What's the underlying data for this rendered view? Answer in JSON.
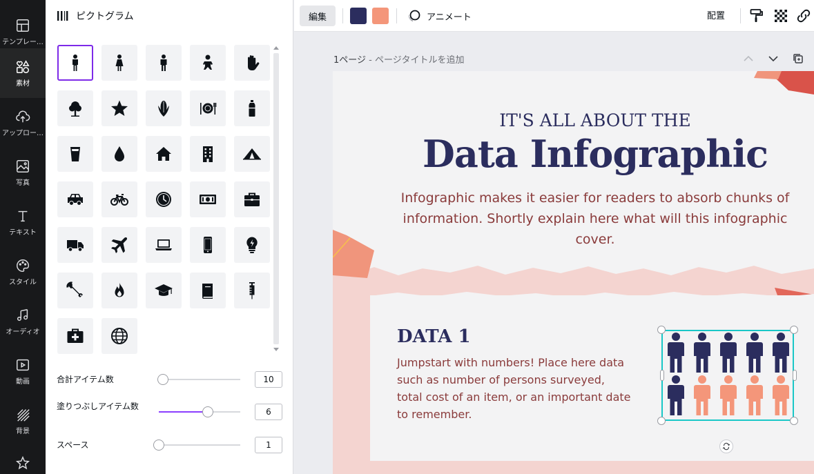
{
  "rail": [
    {
      "label": "テンプレー…",
      "icon": "template-icon"
    },
    {
      "label": "素材",
      "icon": "elements-icon",
      "active": true
    },
    {
      "label": "アップロー…",
      "icon": "upload-icon"
    },
    {
      "label": "写真",
      "icon": "photo-icon"
    },
    {
      "label": "テキスト",
      "icon": "text-icon"
    },
    {
      "label": "スタイル",
      "icon": "palette-icon"
    },
    {
      "label": "オーディオ",
      "icon": "music-icon"
    },
    {
      "label": "動画",
      "icon": "video-icon"
    },
    {
      "label": "背景",
      "icon": "background-icon"
    },
    {
      "label": "",
      "icon": "star-icon"
    }
  ],
  "panel": {
    "title": "ピクトグラム",
    "controls": {
      "total_label": "合計アイテム数",
      "total_value": "10",
      "total_level": 0.05,
      "fill_label": "塗りつぶしアイテム数",
      "fill_value": "6",
      "fill_level": 0.6,
      "space_label": "スペース",
      "space_value": "1",
      "space_level": 0.0
    },
    "icons": [
      "person-icon",
      "woman-icon",
      "man-icon",
      "baby-icon",
      "hand-icon",
      "tree-icon",
      "star-icon",
      "corn-icon",
      "plate-icon",
      "bottle-icon",
      "cup-icon",
      "drop-icon",
      "house-icon",
      "building-icon",
      "tent-icon",
      "car-icon",
      "bicycle-icon",
      "clock-icon",
      "money-icon",
      "briefcase-icon",
      "truck-icon",
      "airplane-icon",
      "laptop-icon",
      "phone-icon",
      "lightbulb-icon",
      "wrench-icon",
      "fire-icon",
      "graduation-cap-icon",
      "book-icon",
      "syringe-icon",
      "first-aid-icon",
      "globe-icon"
    ]
  },
  "topbar": {
    "edit_label": "編集",
    "color1": "#2b2d5e",
    "color2": "#f4967a",
    "animate_label": "アニメート",
    "arrange_label": "配置"
  },
  "page": {
    "number_label": "1ページ",
    "title_placeholder": " - ページタイトルを追加"
  },
  "canvas": {
    "pre_heading": "IT'S ALL ABOUT THE",
    "heading": "Data Infographic",
    "intro": "Infographic makes it easier for readers to absorb chunks of information. Shortly explain here what will this infographic cover.",
    "data1_title": "DATA 1",
    "data1_body": "Jumpstart with numbers! Place here data such as number of persons surveyed, total cost of an item, or an important date to remember.",
    "pictogram": {
      "total": 10,
      "filled": 6,
      "fill_color": "#2b2d5e",
      "other_color": "#f4967a"
    }
  }
}
